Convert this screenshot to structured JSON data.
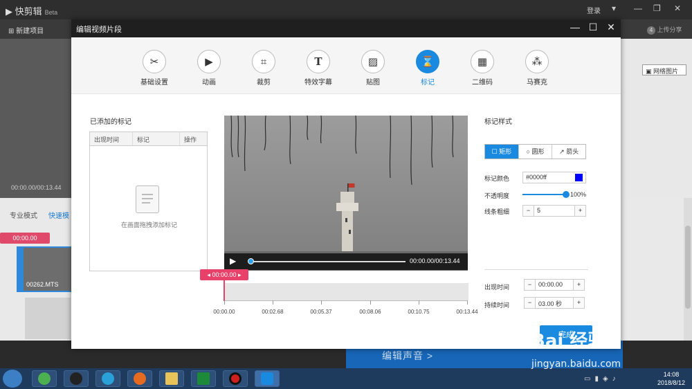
{
  "app": {
    "logo_text": "快剪辑",
    "logo_badge": "Beta",
    "login": "登录",
    "new_project": "新建项目",
    "upload_share": "上传分享",
    "upload_step": "4",
    "net_image": "网络图片",
    "preview_time": "00:00.00/00:13.44",
    "mode_pro": "专业模式",
    "mode_fast": "快速模",
    "bg_timecode": "00:00.00",
    "bg_clip_name": "00262.MTS",
    "edit_audio": "编辑声音 >"
  },
  "dialog": {
    "title": "编辑视频片段",
    "tabs": [
      {
        "label": "基础设置",
        "icon": "scissors-icon"
      },
      {
        "label": "动画",
        "icon": "play-box-icon"
      },
      {
        "label": "裁剪",
        "icon": "crop-icon"
      },
      {
        "label": "特效字幕",
        "icon": "text-icon"
      },
      {
        "label": "贴图",
        "icon": "image-icon"
      },
      {
        "label": "标记",
        "icon": "marker-icon"
      },
      {
        "label": "二维码",
        "icon": "qrcode-icon"
      },
      {
        "label": "马赛克",
        "icon": "mosaic-icon"
      }
    ],
    "active_tab": "标记",
    "added_marks_title": "已添加的标记",
    "table_headers": [
      "出现时间",
      "标记",
      "操作"
    ],
    "empty_hint": "在画面拖拽添加标记",
    "video_time": "00:00.00/00:13.44",
    "timeline_marker": "00:00.00",
    "timeline_ticks": [
      "00:00.00",
      "00:02.68",
      "00:05.37",
      "00:08.06",
      "00:10.75",
      "00:13.44"
    ],
    "mark_style_title": "标记样式",
    "shapes": [
      "矩形",
      "圆形",
      "箭头"
    ],
    "active_shape": "矩形",
    "color_label": "标记颜色",
    "color_value": "#0000ff",
    "color_hex": "#0000ff",
    "opacity_label": "不透明度",
    "opacity_value": "100%",
    "opacity_fraction": 1.0,
    "line_width_label": "线条粗细",
    "line_width": "5",
    "appear_label": "出现时间",
    "appear_time": "00:00.00",
    "duration_label": "持续时间",
    "duration": "03.00 秒",
    "done": "完成"
  },
  "taskbar": {
    "time": "14:08",
    "date": "2018/8/12"
  },
  "watermark": {
    "logo": "Bai 经验",
    "url": "jingyan.baidu.com"
  },
  "colors": {
    "accent": "#1a8ae0",
    "marker_red": "#e8416a",
    "dialog_title_bg": "#1f1f1f"
  }
}
